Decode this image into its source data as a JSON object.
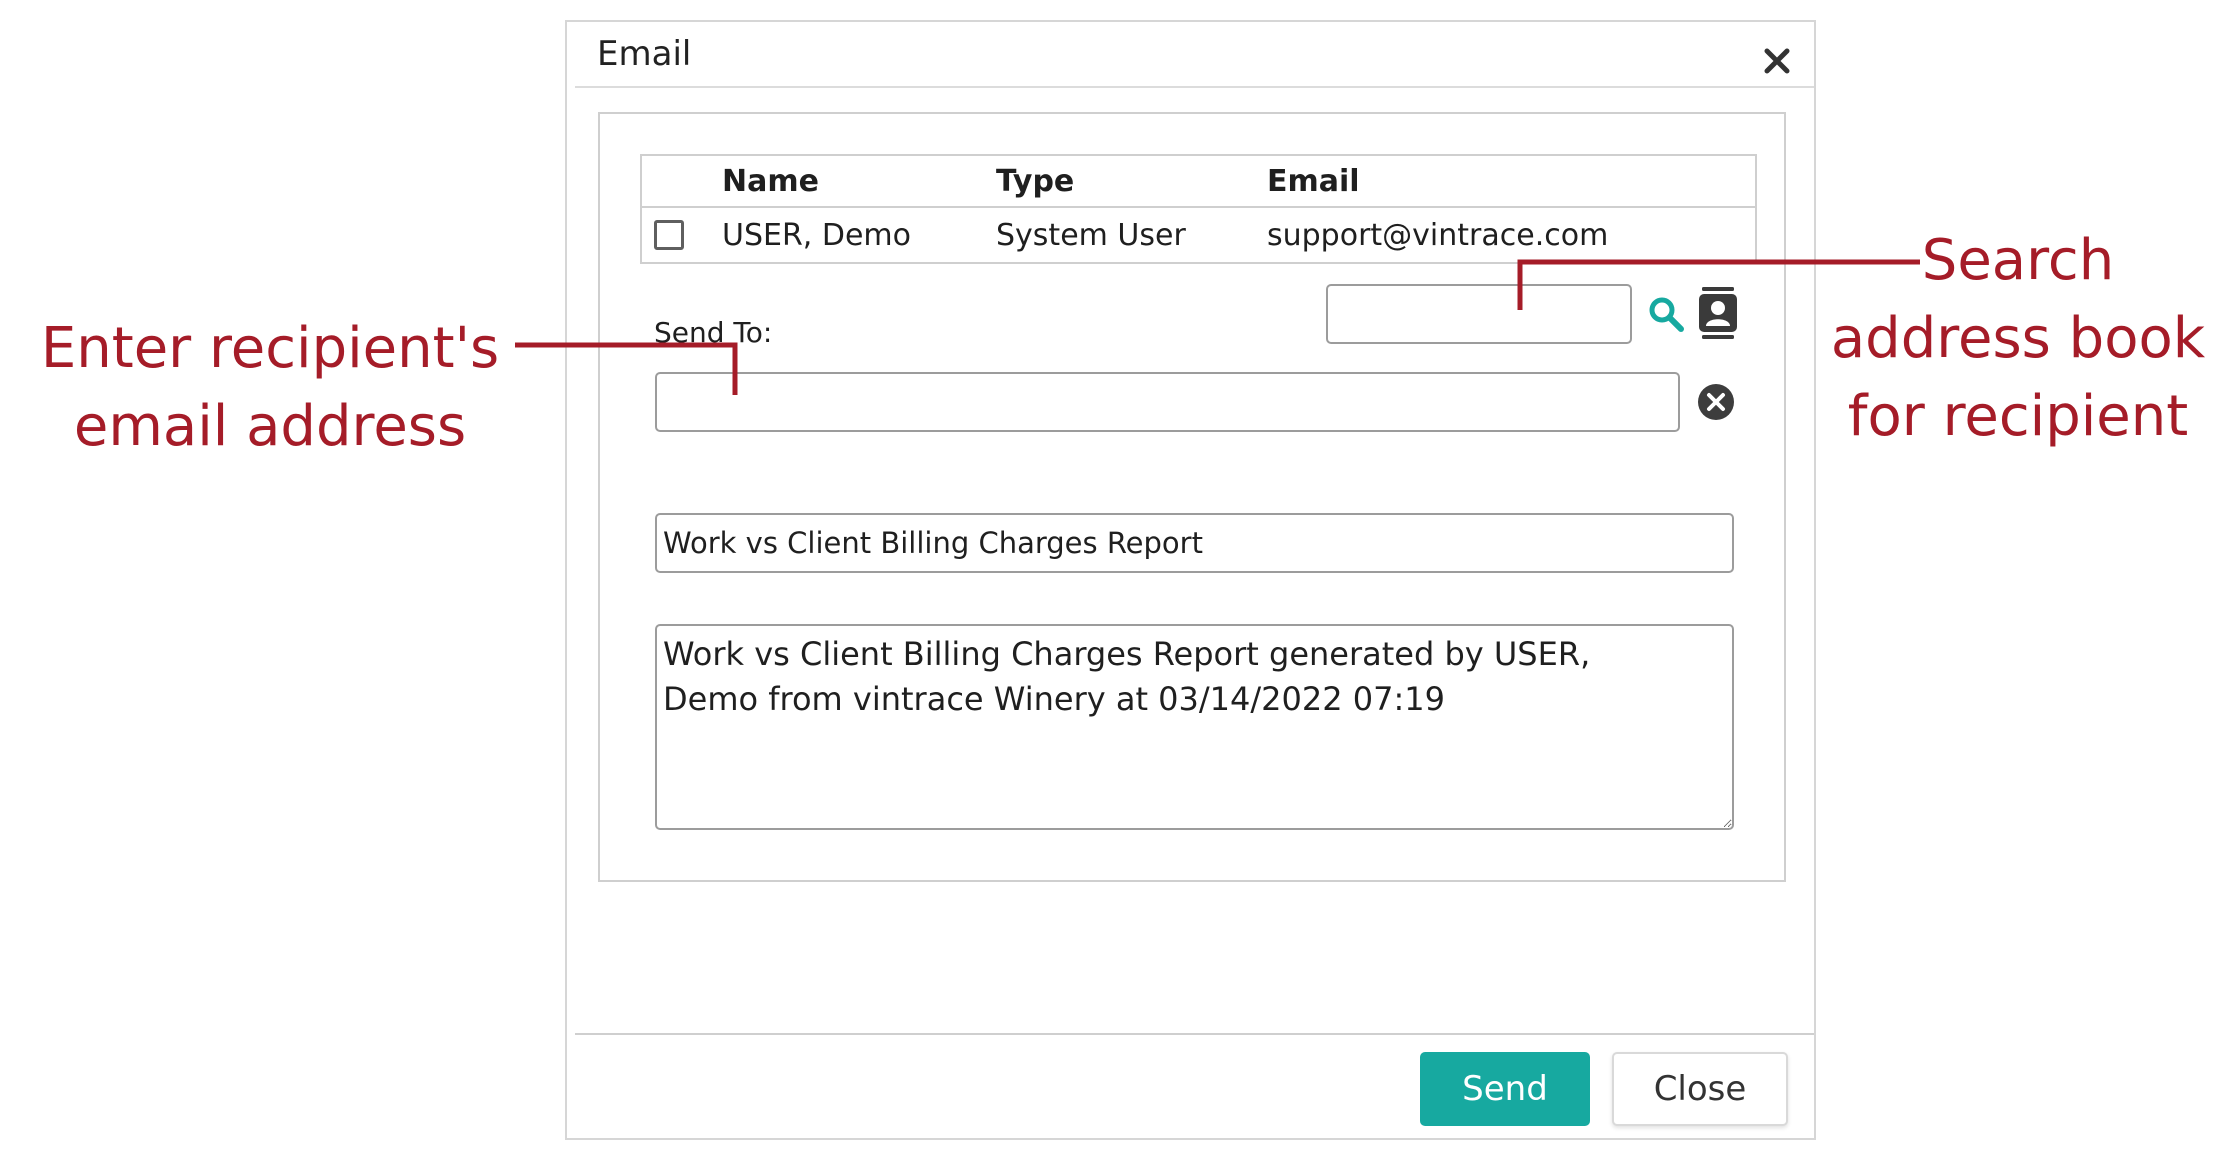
{
  "dialog": {
    "title": "Email",
    "close_icon": "close-icon"
  },
  "recipients_table": {
    "headers": {
      "name": "Name",
      "type": "Type",
      "email": "Email"
    },
    "rows": [
      {
        "checked": false,
        "name": "USER, Demo",
        "type": "System User",
        "email": "support@vintrace.com"
      }
    ]
  },
  "send_to": {
    "label": "Send To:",
    "search_value": "",
    "recipient_value": "",
    "search_icon": "search-icon",
    "address_book_icon": "address-book-icon",
    "clear_icon": "clear-icon"
  },
  "subject": {
    "value": "Work vs Client Billing Charges Report"
  },
  "message": {
    "value": "Work vs Client Billing Charges Report generated by USER,\nDemo from vintrace Winery at 03/14/2022 07:19"
  },
  "footer": {
    "send_label": "Send",
    "close_label": "Close"
  },
  "annotations": {
    "left_line1": "Enter recipient's",
    "left_line2": "email address",
    "right_line1": "Search",
    "right_line2": "address book",
    "right_line3": "for recipient"
  },
  "colors": {
    "accent": "#17a9a0",
    "annotation": "#a51c28"
  }
}
